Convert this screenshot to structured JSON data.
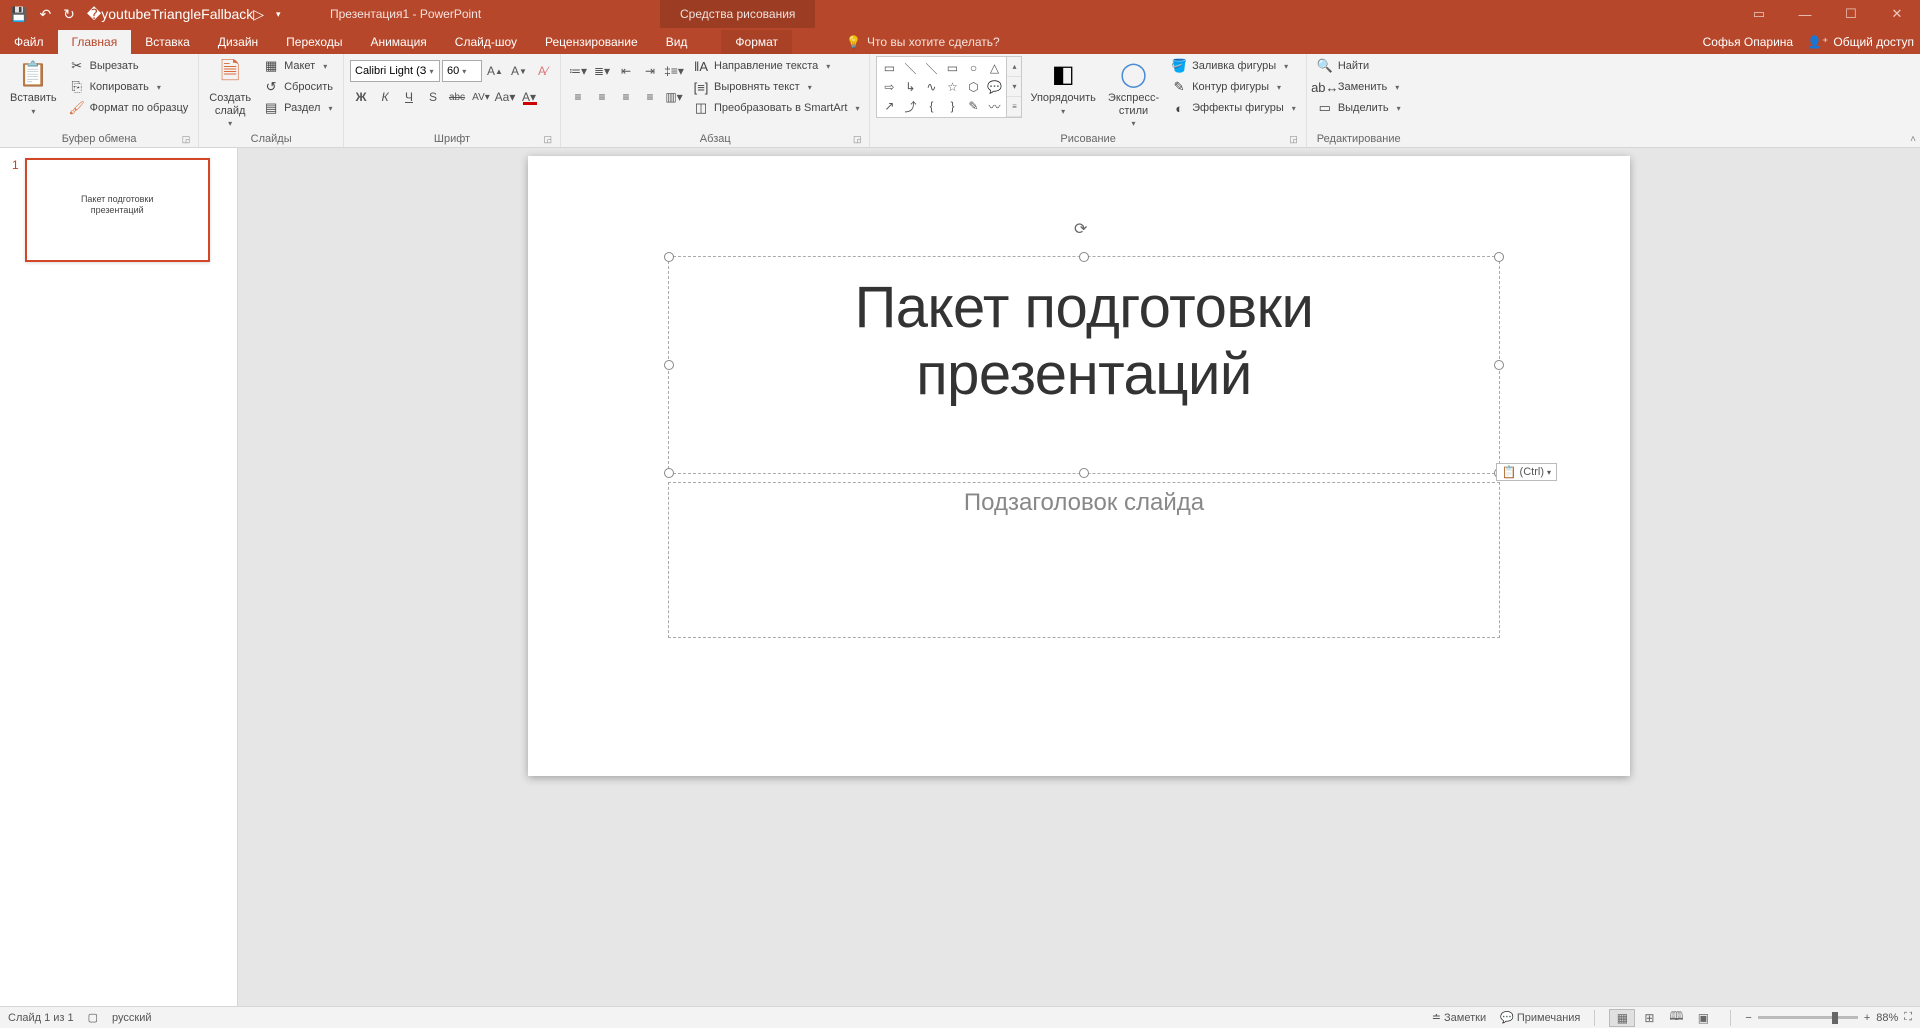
{
  "titlebar": {
    "document_name": "Презентация1",
    "app_name": "PowerPoint",
    "full": "Презентация1 - PowerPoint",
    "context_tool": "Средства рисования"
  },
  "tabs": {
    "file": "Файл",
    "home": "Главная",
    "insert": "Вставка",
    "design": "Дизайн",
    "transitions": "Переходы",
    "animation": "Анимация",
    "slideshow": "Слайд-шоу",
    "review": "Рецензирование",
    "view": "Вид",
    "format": "Формат",
    "tell_me": "Что вы хотите сделать?",
    "user": "Софья Опарина",
    "share": "Общий доступ"
  },
  "ribbon": {
    "clipboard": {
      "paste": "Вставить",
      "cut": "Вырезать",
      "copy": "Копировать",
      "format_painter": "Формат по образцу",
      "label": "Буфер обмена"
    },
    "slides": {
      "new_slide": "Создать\nслайд",
      "layout": "Макет",
      "reset": "Сбросить",
      "section": "Раздел",
      "label": "Слайды"
    },
    "font": {
      "name": "Calibri Light (З",
      "size": "60",
      "label": "Шрифт",
      "bold": "Ж",
      "italic": "К",
      "underline": "Ч",
      "shadow": "S",
      "strike": "abc",
      "spacing": "AV",
      "case": "Aa"
    },
    "paragraph": {
      "text_direction": "Направление текста",
      "align_text": "Выровнять текст",
      "smartart": "Преобразовать в SmartArt",
      "label": "Абзац"
    },
    "drawing": {
      "arrange": "Упорядочить",
      "quick_styles": "Экспресс-\nстили",
      "shape_fill": "Заливка фигуры",
      "shape_outline": "Контур фигуры",
      "shape_effects": "Эффекты фигуры",
      "label": "Рисование"
    },
    "editing": {
      "find": "Найти",
      "replace": "Заменить",
      "select": "Выделить",
      "label": "Редактирование"
    }
  },
  "slide": {
    "number": "1",
    "title": "Пакет подготовки презентаций",
    "subtitle": "Подзаголовок слайда",
    "paste_badge": "(Ctrl)"
  },
  "thumbnail": {
    "title_line1": "Пакет подготовки",
    "title_line2": "презентаций"
  },
  "statusbar": {
    "slide_pos": "Слайд 1 из 1",
    "language": "русский",
    "notes": "Заметки",
    "comments": "Примечания",
    "zoom": "88%"
  }
}
